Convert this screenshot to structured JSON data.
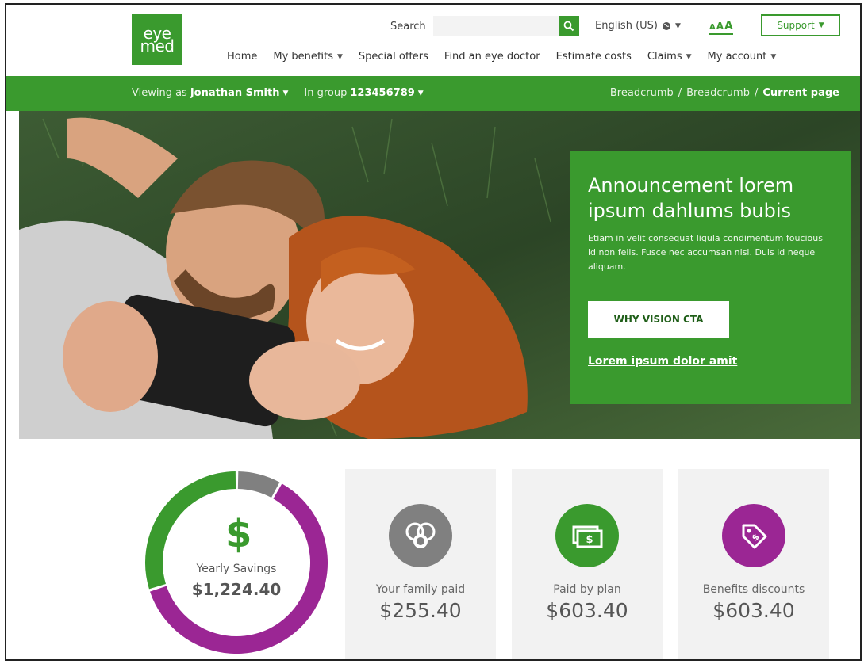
{
  "brand": {
    "logo_text": "eye\nmed",
    "accent": "#3a9a2e",
    "purple": "#9b2694",
    "gray": "#808080"
  },
  "header": {
    "search_label": "Search",
    "search_placeholder": "",
    "language": "English (US)",
    "text_size": [
      "A",
      "A",
      "A"
    ],
    "support_label": "Support"
  },
  "nav": {
    "items": [
      {
        "label": "Home",
        "dropdown": false
      },
      {
        "label": "My benefits",
        "dropdown": true
      },
      {
        "label": "Special offers",
        "dropdown": false
      },
      {
        "label": "Find an eye doctor",
        "dropdown": false
      },
      {
        "label": "Estimate costs",
        "dropdown": false
      },
      {
        "label": "Claims",
        "dropdown": true
      },
      {
        "label": "My account",
        "dropdown": true
      }
    ]
  },
  "context": {
    "viewing_prefix": "Viewing as",
    "member_name": "Jonathan Smith",
    "group_prefix": "In group",
    "group_number": "123456789",
    "breadcrumbs": [
      "Breadcrumb",
      "Breadcrumb"
    ],
    "separator": "/",
    "current_page": "Current page"
  },
  "hero": {
    "title": "Announcement lorem ipsum dahlums bubis",
    "body": "Etiam in velit consequat ligula condimentum foucious id non felis. Fusce nec accumsan nisi. Duis id neque aliquam.",
    "cta_label": "WHY VISION CTA",
    "link_label": "Lorem ipsum dolor amit"
  },
  "savings": {
    "symbol": "$",
    "label": "Yearly Savings",
    "value": "$1,224.40",
    "segments": [
      {
        "name": "family",
        "fraction": 0.08,
        "color": "#808080"
      },
      {
        "name": "plan",
        "fraction": 0.62,
        "color": "#9b2694"
      },
      {
        "name": "discounts",
        "fraction": 0.3,
        "color": "#3a9a2e"
      }
    ]
  },
  "cards": [
    {
      "label": "Your family paid",
      "value": "$255.40",
      "icon": "family-icon",
      "color": "#808080"
    },
    {
      "label": "Paid by plan",
      "value": "$603.40",
      "icon": "cash-icon",
      "color": "#3a9a2e"
    },
    {
      "label": "Benefits discounts",
      "value": "$603.40",
      "icon": "tag-icon",
      "color": "#9b2694"
    }
  ]
}
